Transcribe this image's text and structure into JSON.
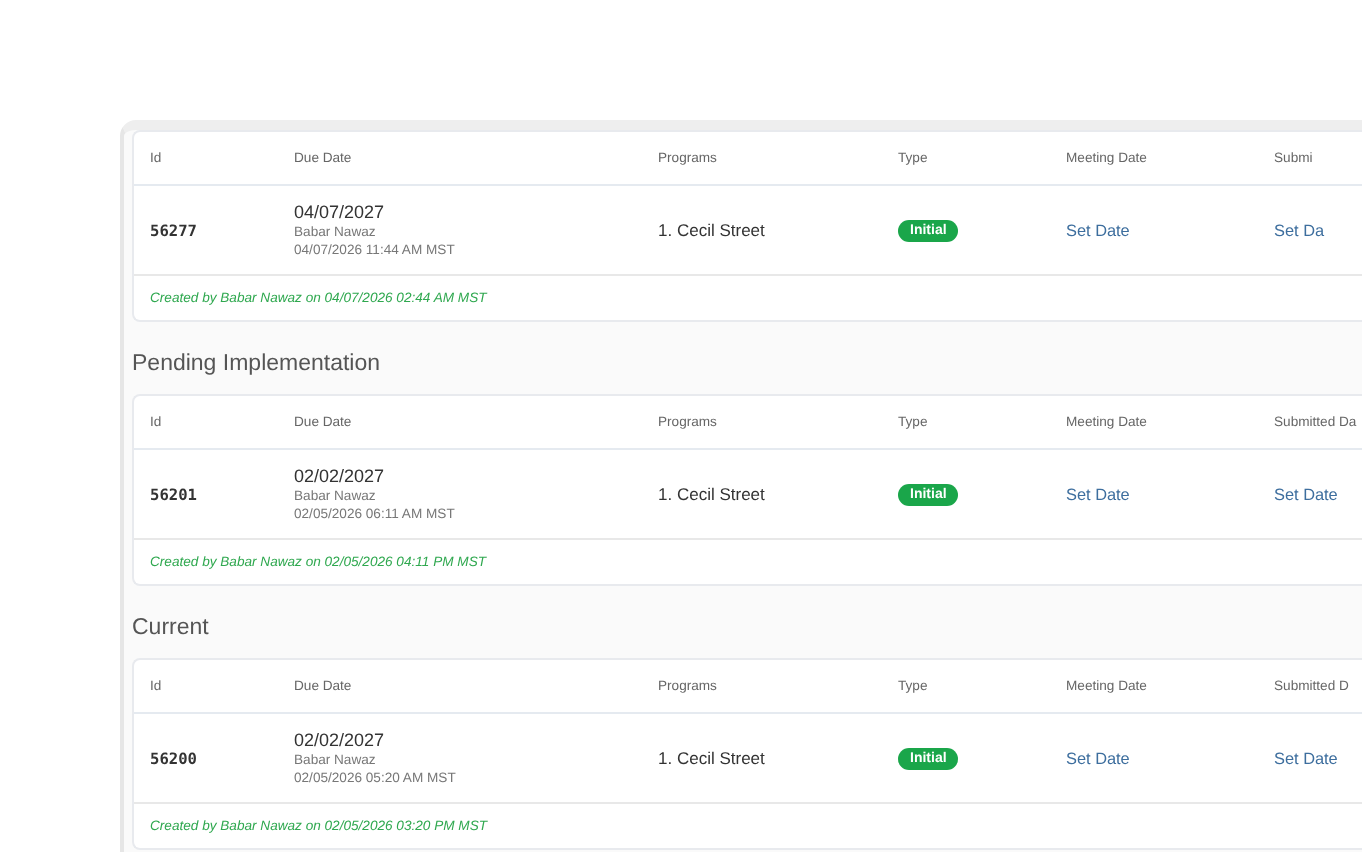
{
  "sections": [
    {
      "columns": [
        "Id",
        "Due Date",
        "Programs",
        "Type",
        "Meeting Date",
        "Submi"
      ],
      "rows": [
        {
          "id": "56277",
          "due_date": "04/07/2027",
          "assignee": "Babar Nawaz",
          "assigned_at": "04/07/2026 11:44 AM MST",
          "program": "1. Cecil Street",
          "type": "Initial",
          "meeting_date": "Set Date",
          "submitted_date": "Set Da",
          "created": "Created by Babar Nawaz on 04/07/2026 02:44 AM MST"
        }
      ]
    },
    {
      "heading": "Pending Implementation",
      "columns": [
        "Id",
        "Due Date",
        "Programs",
        "Type",
        "Meeting Date",
        "Submitted Da"
      ],
      "rows": [
        {
          "id": "56201",
          "due_date": "02/02/2027",
          "assignee": "Babar Nawaz",
          "assigned_at": "02/05/2026 06:11 AM MST",
          "program": "1. Cecil Street",
          "type": "Initial",
          "meeting_date": "Set Date",
          "submitted_date": "Set Date",
          "created": "Created by Babar Nawaz on 02/05/2026 04:11 PM MST"
        }
      ]
    },
    {
      "heading": "Current",
      "columns": [
        "Id",
        "Due Date",
        "Programs",
        "Type",
        "Meeting Date",
        "Submitted D"
      ],
      "rows": [
        {
          "id": "56200",
          "due_date": "02/02/2027",
          "assignee": "Babar Nawaz",
          "assigned_at": "02/05/2026 05:20 AM MST",
          "program": "1. Cecil Street",
          "type": "Initial",
          "meeting_date": "Set Date",
          "submitted_date": "Set Date",
          "created": "Created by Babar Nawaz on 02/05/2026 03:20 PM MST"
        }
      ]
    }
  ]
}
